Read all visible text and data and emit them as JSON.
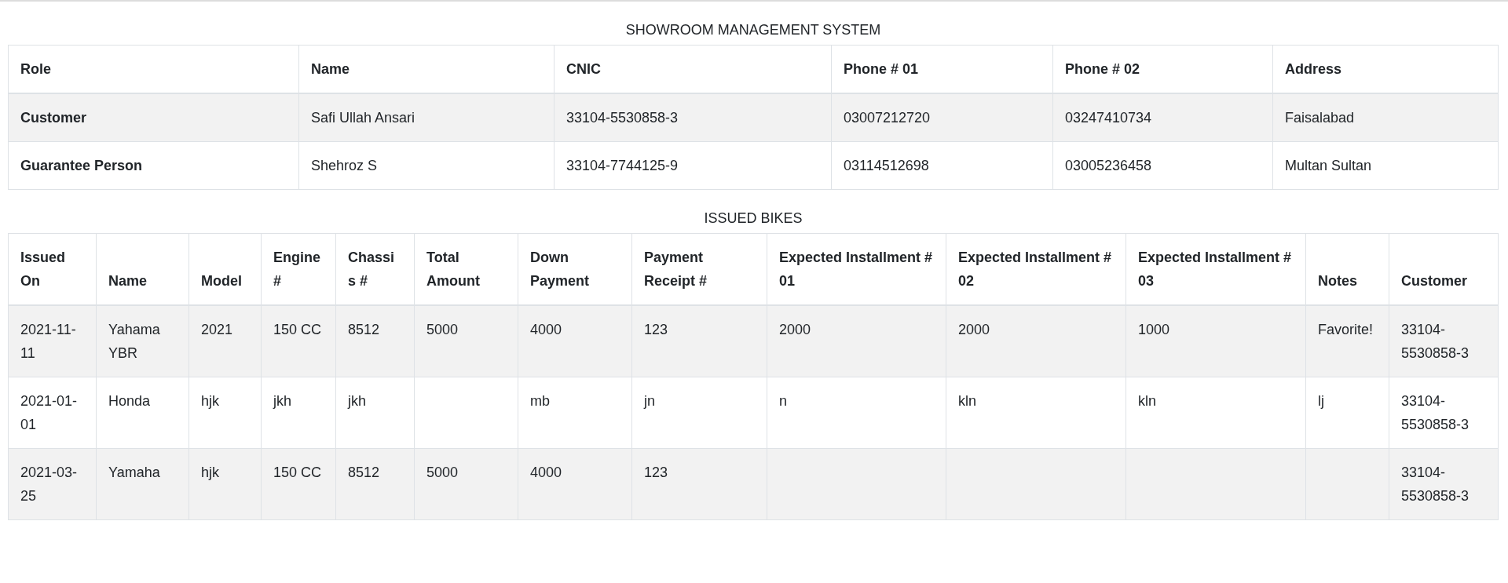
{
  "people_table": {
    "title": "SHOWROOM MANAGEMENT SYSTEM",
    "columns": [
      "Role",
      "Name",
      "CNIC",
      "Phone # 01",
      "Phone # 02",
      "Address"
    ],
    "rows": [
      [
        "Customer",
        "Safi Ullah Ansari",
        "33104-5530858-3",
        "03007212720",
        "03247410734",
        "Faisalabad"
      ],
      [
        "Guarantee Person",
        "Shehroz S",
        "33104-7744125-9",
        "03114512698",
        "03005236458",
        "Multan Sultan"
      ]
    ]
  },
  "bikes_table": {
    "title": "ISSUED BIKES",
    "columns": [
      "Issued On",
      "Name",
      "Model",
      "Engine #",
      "Chassis #",
      "Total Amount",
      "Down Payment",
      "Payment Receipt #",
      "Expected Installment # 01",
      "Expected Installment # 02",
      "Expected Installment # 03",
      "Notes",
      "Customer"
    ],
    "rows": [
      [
        "2021-11-11",
        "Yahama YBR",
        "2021",
        "150 CC",
        "8512",
        "5000",
        "4000",
        "123",
        "2000",
        "2000",
        "1000",
        "Favorite!",
        "33104-5530858-3"
      ],
      [
        "2021-01-01",
        "Honda",
        "hjk",
        "jkh",
        "jkh",
        null,
        "mb",
        "jn",
        "n",
        "kln",
        "kln",
        "lj",
        "33104-5530858-3"
      ],
      [
        "2021-03-25",
        "Yamaha",
        "hjk",
        "150 CC",
        "8512",
        "5000",
        "4000",
        "123",
        null,
        null,
        null,
        null,
        "33104-5530858-3"
      ]
    ]
  }
}
